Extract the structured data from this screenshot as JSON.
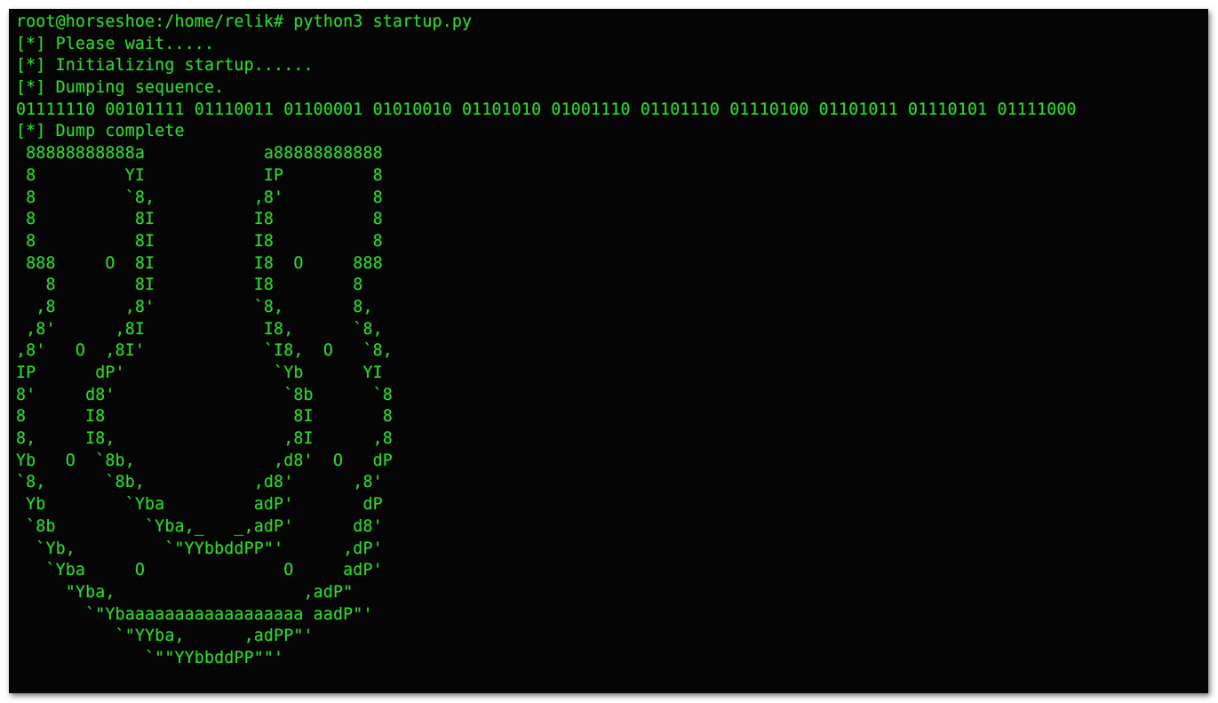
{
  "terminal": {
    "prompt": "root@horseshoe:/home/relik#",
    "command": "python3 startup.py",
    "status_lines": [
      "[*] Please wait.....",
      "[*] Initializing startup......",
      "[*] Dumping sequence."
    ],
    "binary_dump": "01111110 00101111 01110011 01100001 01010010 01101010 01001110 01101110 01110100 01101011 01110101 01111000",
    "dump_complete": "[*] Dump complete",
    "ascii_art": [
      " 88888888888a            a88888888888",
      " 8         YI            IP         8",
      " 8         `8,          ,8'         8",
      " 8          8I          I8          8",
      " 8          8I          I8          8",
      " 888     O  8I          I8  O     888",
      "   8        8I          I8        8",
      "  ,8       ,8'          `8,       8,",
      " ,8'      ,8I            I8,      `8,",
      ",8'   O  ,8I'            `I8,  O   `8,",
      "IP      dP'               `Yb      YI",
      "8'     d8'                 `8b      `8",
      "8      I8                   8I       8",
      "8,     I8,                 ,8I      ,8",
      "Yb   O  `8b,              ,d8'  O   dP",
      "`8,      `8b,           ,d8'      ,8'",
      " Yb        `Yba         adP'       dP",
      " `8b         `Yba,_   _,adP'      d8'",
      "  `Yb,         `\"YYbbddPP\"'      ,dP'",
      "   `Yba     O              O     adP'",
      "     \"Yba,                   ,adP\"",
      "       `\"Ybaaaaaaaaaaaaaaaaaa aadP\"'",
      "          `\"YYba,      ,adPP\"'",
      "             `\"\"YYbbddPP\"\"'"
    ]
  }
}
